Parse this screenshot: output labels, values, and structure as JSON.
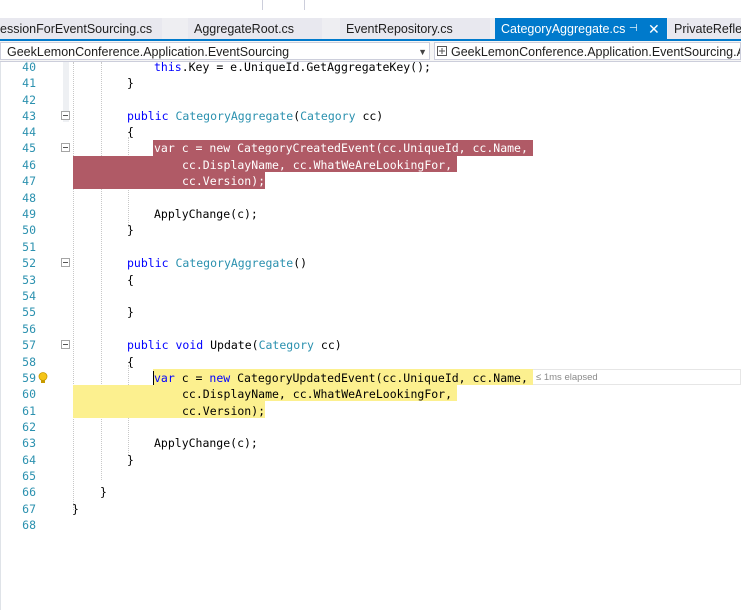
{
  "tabs": [
    {
      "label": "essionForEventSourcing.cs"
    },
    {
      "label": "AggregateRoot.cs"
    },
    {
      "label": "EventRepository.cs"
    },
    {
      "label": "CategoryAggregate.cs",
      "active": true
    },
    {
      "label": "PrivateReflec"
    }
  ],
  "tab_controls": {
    "pin": "⊣",
    "close": "✕"
  },
  "nav": {
    "left": "GeekLemonConference.Application.EventSourcing",
    "right": "GeekLemonConference.Application.EventSourcing.Agg"
  },
  "colors": {
    "accent": "#007acc",
    "selection_red": "#b05a66",
    "highlight_yellow": "#fcf08f",
    "keyword": "#0000ff",
    "type": "#2b91af"
  },
  "line_numbers": [
    "40",
    "41",
    "42",
    "43",
    "44",
    "45",
    "46",
    "47",
    "48",
    "49",
    "50",
    "51",
    "52",
    "53",
    "54",
    "55",
    "56",
    "57",
    "58",
    "59",
    "60",
    "61",
    "62",
    "63",
    "64",
    "65",
    "66",
    "67",
    "68"
  ],
  "code": {
    "l40": "this.Key = e.UniqueId.GetAggregateKey();",
    "l41": "}",
    "l43": {
      "kw": "public",
      "type": "CategoryAggregate",
      "p1": "(",
      "ptype": "Category",
      "rest": " cc)"
    },
    "l44": "{",
    "l45": {
      "kw": "var",
      "a": " c = ",
      "kw2": "new",
      "b": " CategoryCreatedEvent(cc.UniqueId, cc.Name,"
    },
    "l46": "cc.DisplayName, cc.WhatWeAreLookingFor,",
    "l47": "cc.Version);",
    "l49": "ApplyChange(c);",
    "l50": "}",
    "l52": {
      "kw": "public",
      "type": "CategoryAggregate",
      "rest": "()"
    },
    "l53": "{",
    "l55": "}",
    "l57": {
      "kw": "public",
      "kw2": "void",
      "name": " Update(",
      "ptype": "Category",
      "rest": " cc)"
    },
    "l58": "{",
    "l59": {
      "kw": "var",
      "a": " c = ",
      "kw2": "new",
      "b": " CategoryUpdatedEvent(cc.UniqueId, cc.Name,"
    },
    "l60": "cc.DisplayName, cc.WhatWeAreLookingFor,",
    "l61": "cc.Version);",
    "l63": "ApplyChange(c);",
    "l64": "}",
    "l66": "}",
    "l67": "}"
  },
  "perf_tip": "≤ 1ms elapsed",
  "icons": {
    "bulb": "lightbulb-icon",
    "nav": "namespace-icon"
  }
}
